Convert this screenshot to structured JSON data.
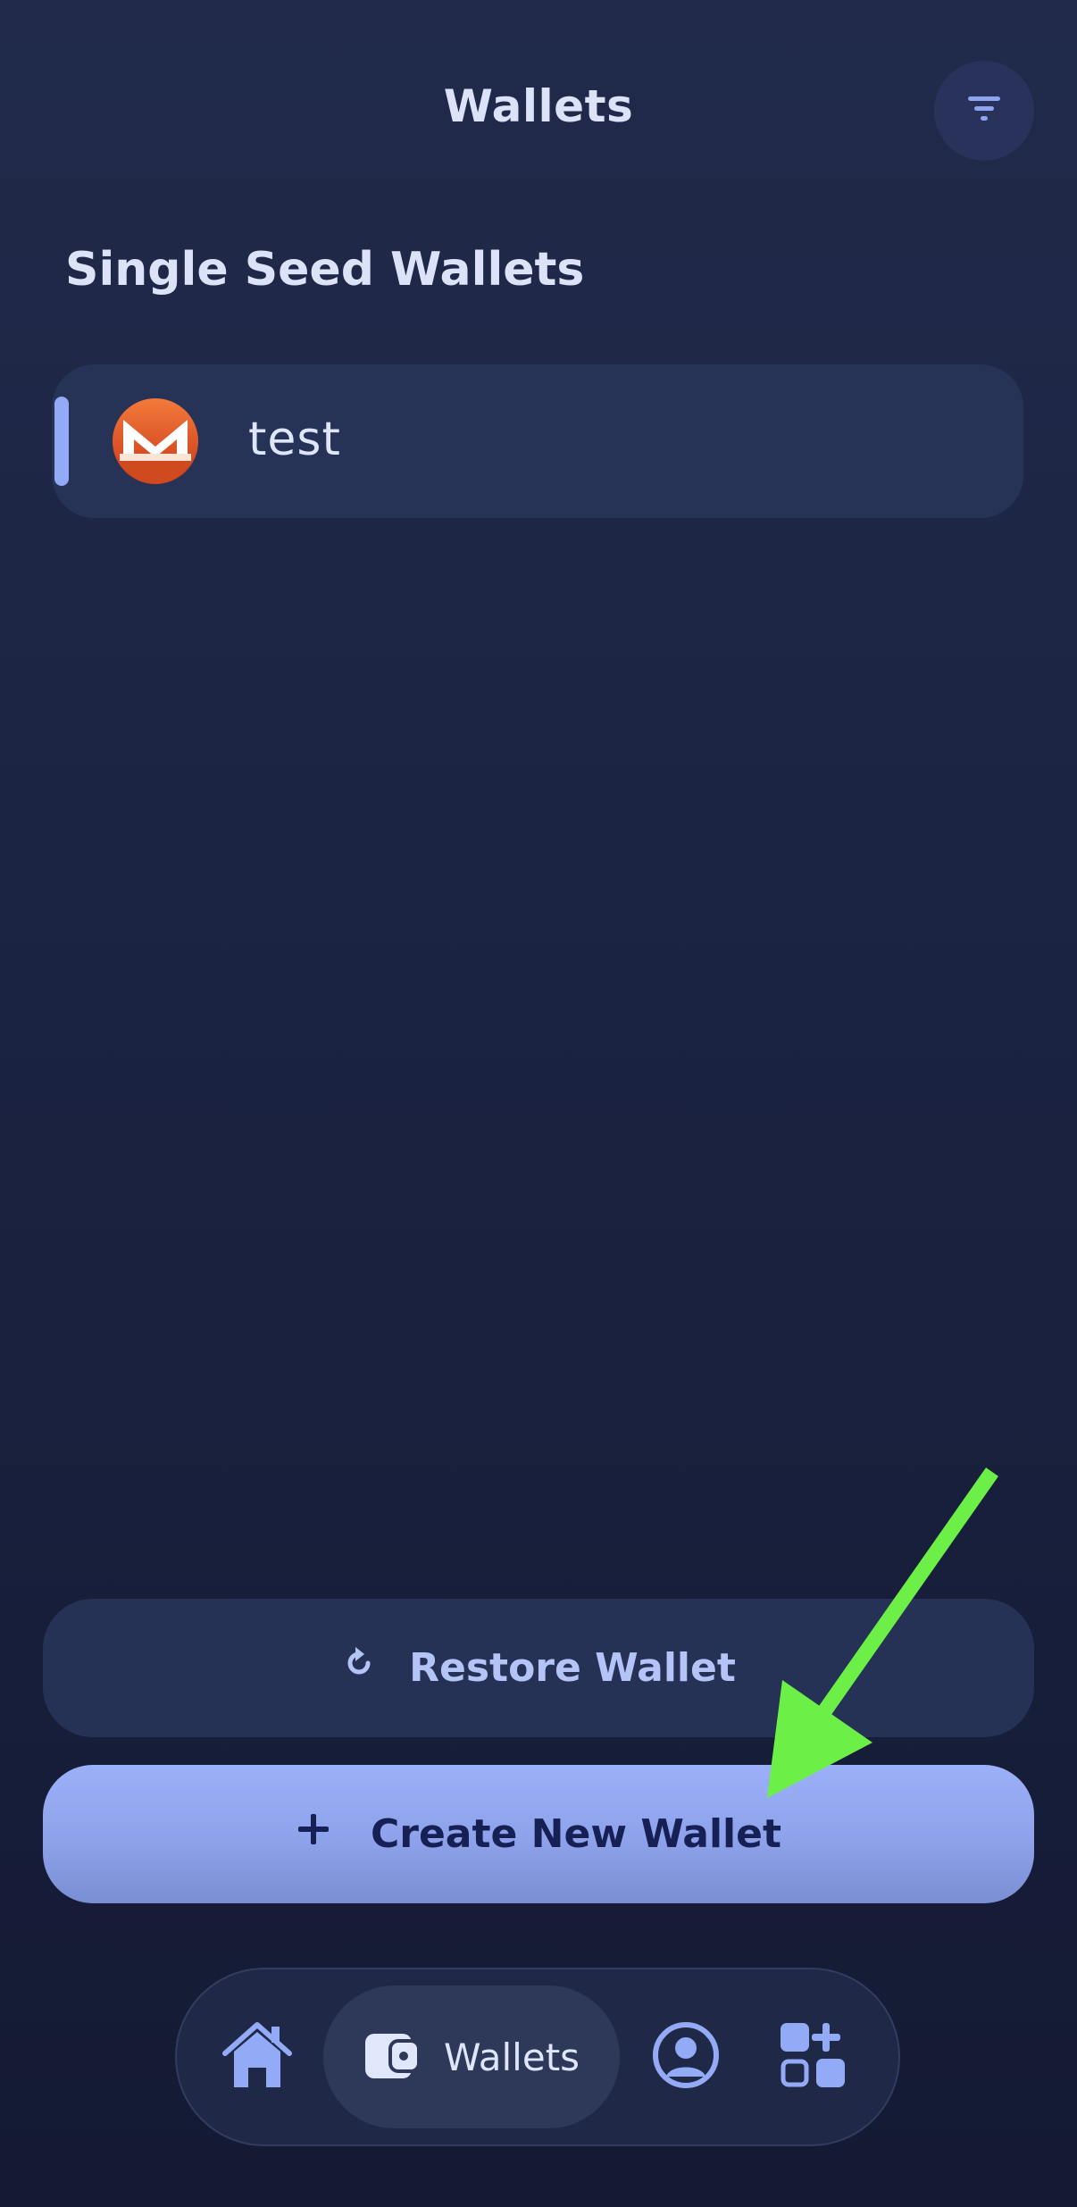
{
  "header": {
    "title": "Wallets",
    "filter_icon": "filter-icon"
  },
  "section": {
    "title": "Single Seed Wallets"
  },
  "wallets": [
    {
      "name": "test",
      "coin_icon": "monero-icon",
      "selected": true
    }
  ],
  "actions": {
    "restore_label": "Restore Wallet",
    "restore_icon": "refresh-icon",
    "create_label": "Create New Wallet",
    "create_icon": "plus-icon"
  },
  "nav": {
    "items": [
      {
        "icon": "home-icon",
        "label": "",
        "active": false
      },
      {
        "icon": "wallet-icon",
        "label": "Wallets",
        "active": true
      },
      {
        "icon": "profile-icon",
        "label": "",
        "active": false
      },
      {
        "icon": "apps-icon",
        "label": "",
        "active": false
      }
    ]
  },
  "annotation": {
    "arrow_color": "#6cf048",
    "arrow_icon": "green-arrow-icon"
  },
  "colors": {
    "accent": "#93aaf6",
    "background": "#1b2342",
    "card": "#273257",
    "primary_button": "#8da2ea",
    "monero_orange": "#f26822"
  }
}
